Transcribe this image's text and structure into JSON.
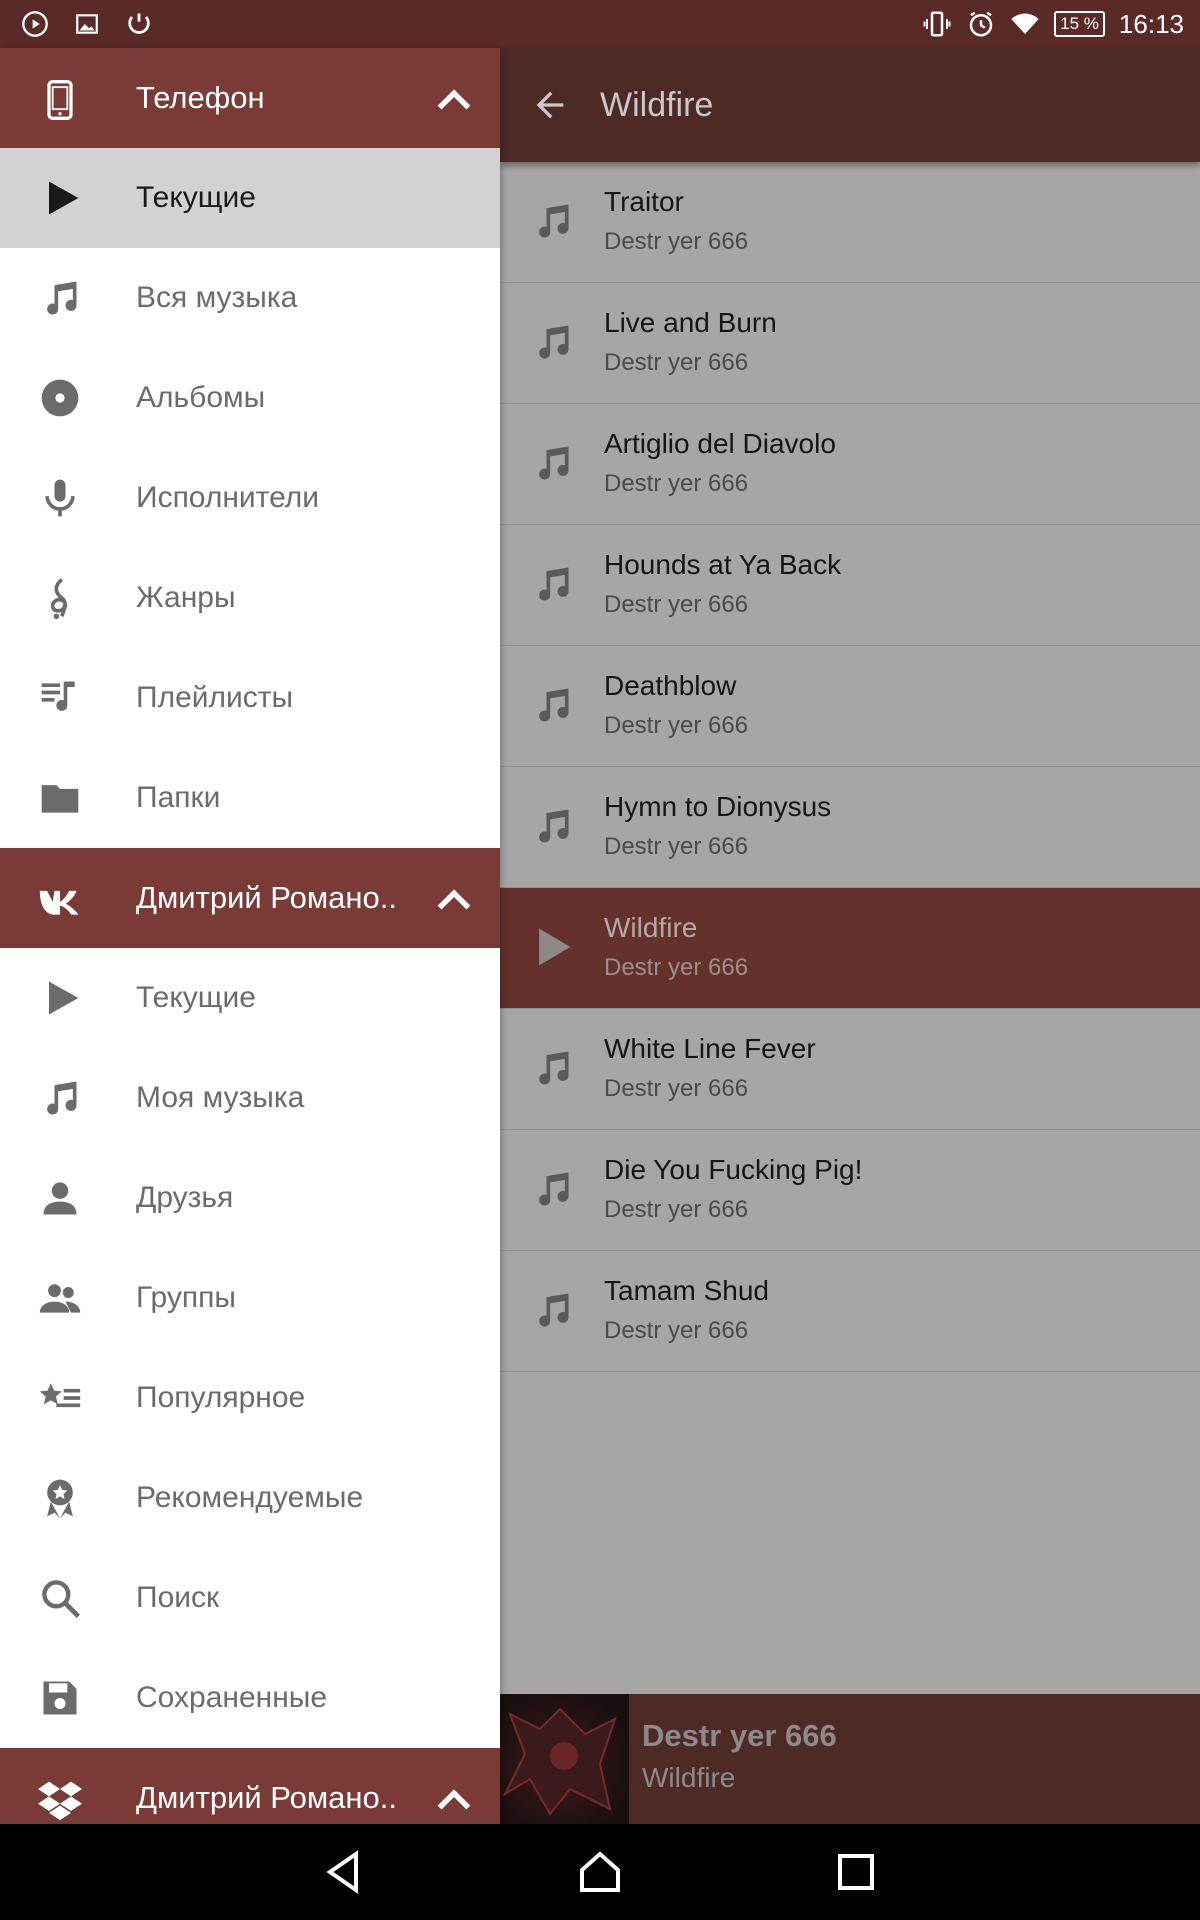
{
  "status_bar": {
    "battery": "15 %",
    "time": "16:13"
  },
  "colors": {
    "primary_dark": "#4e2a27",
    "header": "#7a3b36",
    "current_track": "#64312d",
    "list_background": "#a6a6a6"
  },
  "drawer": {
    "sections": [
      {
        "title": "Телефон",
        "icon": "phone-icon",
        "items": [
          {
            "label": "Текущие",
            "icon": "play-icon",
            "active": true
          },
          {
            "label": "Вся музыка",
            "icon": "music-note-icon"
          },
          {
            "label": "Альбомы",
            "icon": "album-icon"
          },
          {
            "label": "Исполнители",
            "icon": "microphone-icon"
          },
          {
            "label": "Жанры",
            "icon": "treble-clef-icon"
          },
          {
            "label": "Плейлисты",
            "icon": "playlist-icon"
          },
          {
            "label": "Папки",
            "icon": "folder-icon"
          }
        ]
      },
      {
        "title": "Дмитрий Романо..",
        "icon": "vk-icon",
        "items": [
          {
            "label": "Текущие",
            "icon": "play-icon"
          },
          {
            "label": "Моя музыка",
            "icon": "music-note-icon"
          },
          {
            "label": "Друзья",
            "icon": "person-icon"
          },
          {
            "label": "Группы",
            "icon": "group-icon"
          },
          {
            "label": "Популярное",
            "icon": "star-list-icon"
          },
          {
            "label": "Рекомендуемые",
            "icon": "award-icon"
          },
          {
            "label": "Поиск",
            "icon": "search-icon"
          },
          {
            "label": "Сохраненные",
            "icon": "save-icon"
          }
        ]
      },
      {
        "title": "Дмитрий Романо..",
        "icon": "dropbox-icon",
        "items": []
      }
    ]
  },
  "main": {
    "title": "Wildfire",
    "tracks": [
      {
        "title": "Traitor",
        "artist": "Destr yer 666"
      },
      {
        "title": "Live and Burn",
        "artist": "Destr yer 666"
      },
      {
        "title": "Artiglio del Diavolo",
        "artist": "Destr yer 666"
      },
      {
        "title": "Hounds at Ya Back",
        "artist": "Destr yer 666"
      },
      {
        "title": "Deathblow",
        "artist": "Destr yer 666"
      },
      {
        "title": "Hymn to Dionysus",
        "artist": "Destr yer 666"
      },
      {
        "title": "Wildfire",
        "artist": "Destr yer 666",
        "current": true
      },
      {
        "title": "White Line Fever",
        "artist": "Destr yer 666"
      },
      {
        "title": "Die You Fucking Pig!",
        "artist": "Destr yer 666"
      },
      {
        "title": "Tamam Shud",
        "artist": "Destr yer 666"
      }
    ]
  },
  "now_playing": {
    "artist": "Destr yer 666",
    "title": "Wildfire"
  }
}
